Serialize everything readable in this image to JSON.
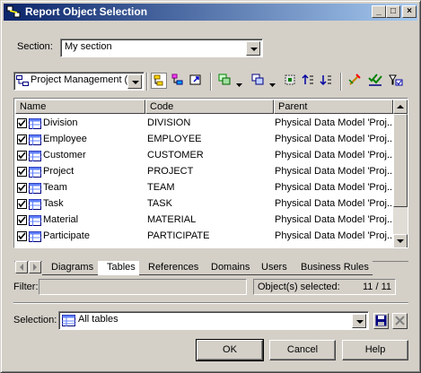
{
  "window": {
    "title": "Report Object Selection",
    "controls": {
      "minimize": "_",
      "maximize": "□",
      "close": "×"
    }
  },
  "section": {
    "label": "Section:",
    "value": "My section"
  },
  "model_selector": {
    "value": "Project Management (PD"
  },
  "toolbar": {
    "icons": [
      "model-tree-icon",
      "select-tree-icon",
      "external-icon",
      "include-icon",
      "shortcut-icon",
      "find-icon",
      "move-up-icon",
      "move-down-icon",
      "filter-icon",
      "check-all-icon",
      "uncheck-all-icon"
    ]
  },
  "table": {
    "columns": [
      "Name",
      "Code",
      "Parent"
    ],
    "rows": [
      {
        "checked": true,
        "name": "Division",
        "code": "DIVISION",
        "parent": "Physical Data Model 'Proj..."
      },
      {
        "checked": true,
        "name": "Employee",
        "code": "EMPLOYEE",
        "parent": "Physical Data Model 'Proj..."
      },
      {
        "checked": true,
        "name": "Customer",
        "code": "CUSTOMER",
        "parent": "Physical Data Model 'Proj..."
      },
      {
        "checked": true,
        "name": "Project",
        "code": "PROJECT",
        "parent": "Physical Data Model 'Proj..."
      },
      {
        "checked": true,
        "name": "Team",
        "code": "TEAM",
        "parent": "Physical Data Model 'Proj..."
      },
      {
        "checked": true,
        "name": "Task",
        "code": "TASK",
        "parent": "Physical Data Model 'Proj..."
      },
      {
        "checked": true,
        "name": "Material",
        "code": "MATERIAL",
        "parent": "Physical Data Model 'Proj..."
      },
      {
        "checked": true,
        "name": "Participate",
        "code": "PARTICIPATE",
        "parent": "Physical Data Model 'Proj..."
      }
    ]
  },
  "tabs": {
    "items": [
      "Diagrams",
      "Tables",
      "References",
      "Domains",
      "Users",
      "Business Rules"
    ],
    "active": "Tables"
  },
  "filter": {
    "label": "Filter:",
    "value": ""
  },
  "selected": {
    "label": "Object(s) selected:",
    "value": "11 / 11"
  },
  "selection": {
    "label": "Selection:",
    "value": "All tables"
  },
  "buttons": {
    "ok": "OK",
    "cancel": "Cancel",
    "help": "Help"
  },
  "colors": {
    "titlebar_start": "#0a246a",
    "titlebar_end": "#a6caf0",
    "face": "#d4d0c8"
  }
}
